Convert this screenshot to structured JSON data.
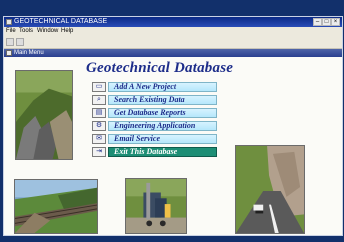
{
  "window": {
    "title": "GEOTECHNICAL DATABASE",
    "subtitle": "Main Menu"
  },
  "menu_bar": [
    "File",
    "Tools",
    "Window",
    "Help"
  ],
  "toolbar": {
    "icons": [
      "save-icon",
      "open-icon"
    ]
  },
  "header": {
    "title": "Geotechnical Database"
  },
  "menu_items": [
    {
      "label": "Add A New Project",
      "icon": "page-icon"
    },
    {
      "label": "Search Existing Data",
      "icon": "search-icon"
    },
    {
      "label": "Get Database Reports",
      "icon": "reports-icon"
    },
    {
      "label": "Engineering Application",
      "icon": "engineering-icon"
    },
    {
      "label": "Email Service",
      "icon": "mail-icon"
    },
    {
      "label": "Exit This Database",
      "icon": "exit-icon"
    }
  ],
  "colors": {
    "title_blue": "#1d2d8a",
    "button_cyan": "#b5e7fb",
    "exit_green": "#1d8e75",
    "frame_navy": "#12306b"
  }
}
